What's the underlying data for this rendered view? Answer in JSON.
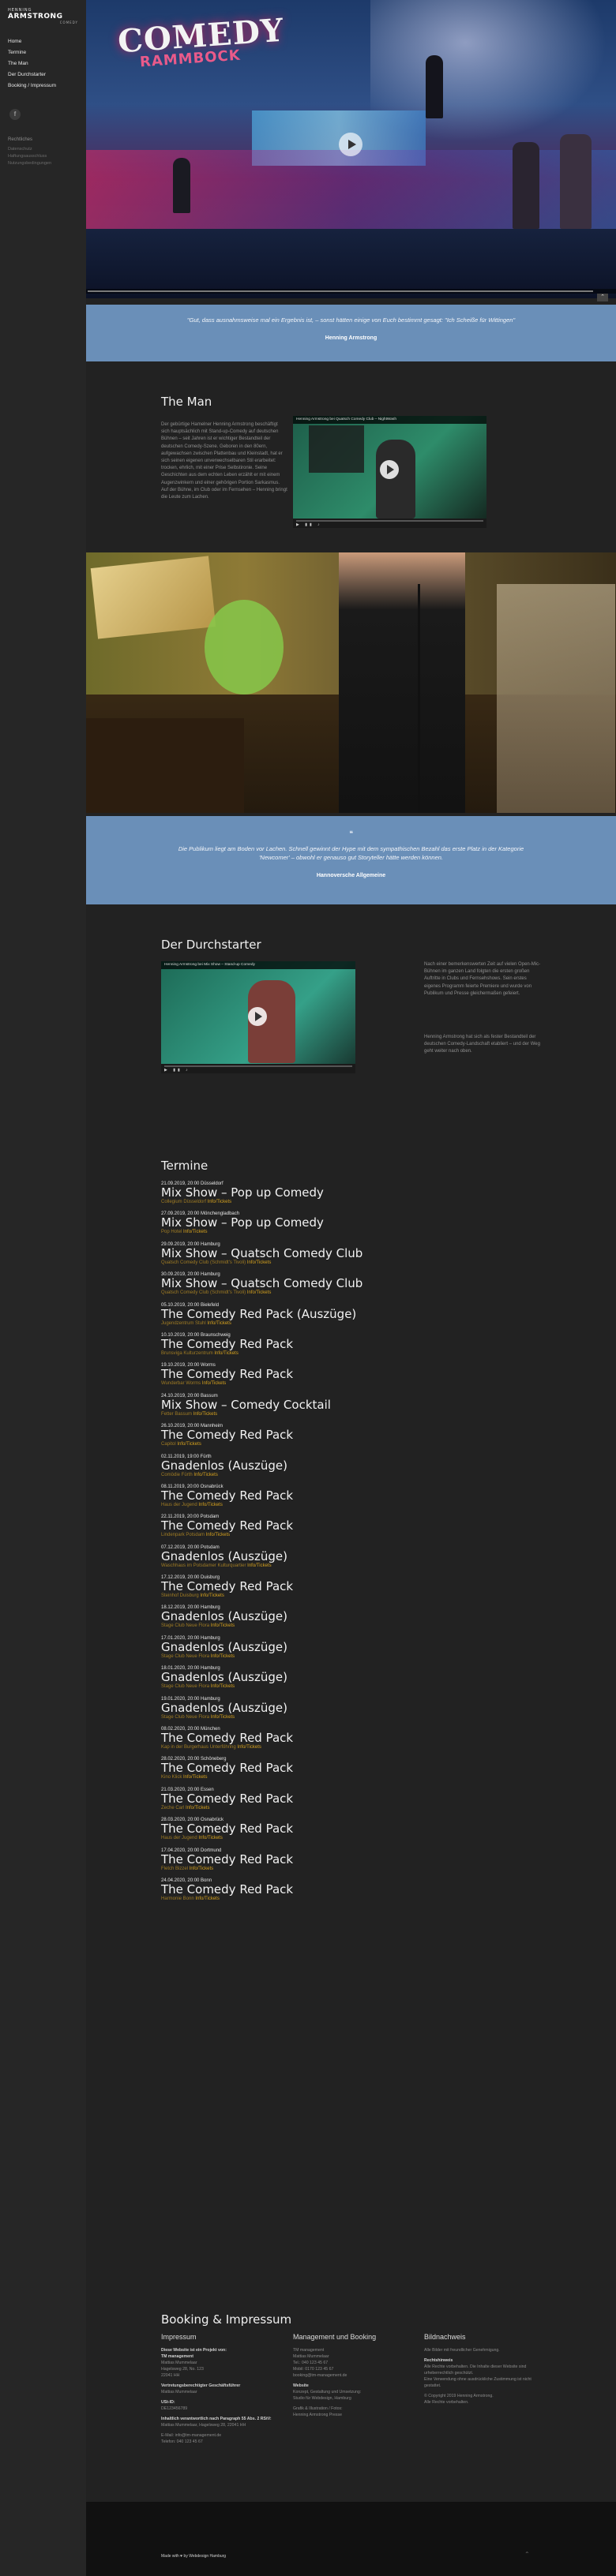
{
  "sidebar": {
    "logo": {
      "line1": "HENNING",
      "line2": "ARMSTRONG",
      "line3": "COMEDY"
    },
    "nav": [
      "Home",
      "Termine",
      "The Man",
      "Der Durchstarter",
      "Booking / Impressum"
    ],
    "legal_title": "Rechtliches",
    "legal_items": [
      "Datenschutz",
      "Haftungsausschluss",
      "Nutzungsbedingungen"
    ]
  },
  "hero": {
    "stage_title": "COMEDY",
    "stage_sub": "RAMMBOCK"
  },
  "quote1": {
    "text": "\"Gut, dass ausnahmsweise mal ein Ergebnis ist, – sonst hätten einige von Euch bestimmt gesagt: \"Ich Scheiße für Wittingen\"",
    "author": "Henning Armstrong"
  },
  "the_man": {
    "title": "The Man",
    "text": "Der gebürtige Hamelner Henning Armstrong beschäftigt sich hauptsächlich mit Stand-up-Comedy auf deutschen Bühnen – seit Jahren ist er wichtiger Bestandteil der deutschen Comedy-Szene. Geboren in den 80ern, aufgewachsen zwischen Plattenbau und Kleinstadt, hat er sich seinen eigenen unverwechselbaren Stil erarbeitet: trocken, ehrlich, mit einer Prise Selbstironie. Seine Geschichten aus dem echten Leben erzählt er mit einem Augenzwinkern und einer gehörigen Portion Sarkasmus. Auf der Bühne, im Club oder im Fernsehen – Henning bringt die Leute zum Lachen.",
    "video_title": "Henning Armstrong bei Quatsch Comedy Club – NightWash"
  },
  "quote2": {
    "icon": "❝",
    "text": "Die Publikum liegt am Boden vor Lachen. Schnell gewinnt der Hype mit dem sympathischen Bezahl das erste Platz in der Kategorie 'Newcomer' – obwohl er genauso gut Storyteller hätte werden können.",
    "author": "Hannoversche Allgemeine"
  },
  "durchstarter": {
    "title": "Der Durchstarter",
    "video_title": "Henning Armstrong bei Mix Show – Stand-up Comedy",
    "text1": "Nach einer bemerkenswerten Zeit auf vielen Open-Mic-Bühnen im ganzen Land folgten die ersten großen Auftritte in Clubs und Fernsehshows. Sein erstes eigenes Programm feierte Premiere und wurde von Publikum und Presse gleichermaßen gefeiert.",
    "text2": "Henning Armstrong hat sich als fester Bestandteil der deutschen Comedy-Landschaft etabliert – und der Weg geht weiter nach oben."
  },
  "termine": {
    "title": "Termine",
    "info_label": "Info/Tickets",
    "events": [
      {
        "date": "21.09.2019, 20:00 Düsseldorf",
        "title": "Mix Show – Pop up Comedy",
        "venue": "Collegium Düsseldorf"
      },
      {
        "date": "27.09.2019, 20:00 Mönchengladbach",
        "title": "Mix Show – Pop up Comedy",
        "venue": "Pop Hotel"
      },
      {
        "date": "29.09.2019, 20:00 Hamburg",
        "title": "Mix Show – Quatsch Comedy Club",
        "venue": "Quatsch Comedy Club (Schmidt's Tivoli)"
      },
      {
        "date": "30.09.2019, 20:00 Hamburg",
        "title": "Mix Show – Quatsch Comedy Club",
        "venue": "Quatsch Comedy Club (Schmidt's Tivoli)"
      },
      {
        "date": "05.10.2019, 20:00 Bielefeld",
        "title": "The Comedy Red Pack (Auszüge)",
        "venue": "Jugendzentrum Stuhl"
      },
      {
        "date": "10.10.2019, 20:00 Braunschweig",
        "title": "The Comedy Red Pack",
        "venue": "Brunsviga Kulturzentrum"
      },
      {
        "date": "19.10.2019, 20:00 Worms",
        "title": "The Comedy Red Pack",
        "venue": "Wunderbar Worms"
      },
      {
        "date": "24.10.2019, 20:00 Bassum",
        "title": "Mix Show – Comedy Cocktail",
        "venue": "Fetter Bassum"
      },
      {
        "date": "26.10.2019, 20:00 Mannheim",
        "title": "The Comedy Red Pack",
        "venue": "Capitol"
      },
      {
        "date": "02.11.2019, 19:00 Fürth",
        "title": "Gnadenlos (Auszüge)",
        "venue": "Comödie Fürth"
      },
      {
        "date": "08.11.2019, 20:00 Osnabrück",
        "title": "The Comedy Red Pack",
        "venue": "Haus der Jugend"
      },
      {
        "date": "22.11.2019, 20:00 Potsdam",
        "title": "The Comedy Red Pack",
        "venue": "Lindenpark Potsdam"
      },
      {
        "date": "07.12.2019, 20:00 Potsdam",
        "title": "Gnadenlos (Auszüge)",
        "venue": "Waschhaus im Potsdamer Kulturquartier"
      },
      {
        "date": "17.12.2019, 20:00 Duisburg",
        "title": "The Comedy Red Pack",
        "venue": "Steinhof Duisburg"
      },
      {
        "date": "18.12.2019, 20:00 Hamburg",
        "title": "Gnadenlos (Auszüge)",
        "venue": "Stage Club Neue Flora"
      },
      {
        "date": "17.01.2020, 20:00 Hamburg",
        "title": "Gnadenlos (Auszüge)",
        "venue": "Stage Club Neue Flora"
      },
      {
        "date": "18.01.2020, 20:00 Hamburg",
        "title": "Gnadenlos (Auszüge)",
        "venue": "Stage Club Neue Flora"
      },
      {
        "date": "19.01.2020, 20:00 Hamburg",
        "title": "Gnadenlos (Auszüge)",
        "venue": "Stage Club Neue Flora"
      },
      {
        "date": "08.02.2020, 20:00 München",
        "title": "The Comedy Red Pack",
        "venue": "Kap in der Burgerhaus Unterföhring"
      },
      {
        "date": "28.02.2020, 20:00 Schöneberg",
        "title": "The Comedy Red Pack",
        "venue": "Kino Klick"
      },
      {
        "date": "21.03.2020, 20:00 Essen",
        "title": "The Comedy Red Pack",
        "venue": "Zeche Carl"
      },
      {
        "date": "28.03.2020, 20:00 Osnabrück",
        "title": "The Comedy Red Pack",
        "venue": "Haus der Jugend"
      },
      {
        "date": "17.04.2020, 20:00 Dortmund",
        "title": "The Comedy Red Pack",
        "venue": "Fletch Bizzel"
      },
      {
        "date": "24.04.2020, 20:00 Bonn",
        "title": "The Comedy Red Pack",
        "venue": "Harmonie Bonn"
      }
    ]
  },
  "booking": {
    "title": "Booking & Impressum",
    "col1": {
      "head": "Impressum",
      "lines": [
        {
          "t": "Diese Website ist ein Projekt von:",
          "b": true
        },
        {
          "t": "TM management",
          "b": true
        },
        {
          "t": "Mattias Mummelaar",
          "b": false
        },
        {
          "t": "Hagelsweg 28, No. 123",
          "b": false
        },
        {
          "t": "22041 HH",
          "b": false
        },
        {
          "t": "",
          "b": false
        },
        {
          "t": "Vertretungsberechtigter Geschäftsführer",
          "b": true
        },
        {
          "t": "Mattias Mummelaar",
          "b": false
        },
        {
          "t": "",
          "b": false
        },
        {
          "t": "USt-ID:",
          "b": true
        },
        {
          "t": "DE123456789",
          "b": false
        },
        {
          "t": "",
          "b": false
        },
        {
          "t": "Inhaltlich verantwortlich nach Paragraph 55 Abs. 2 RStV:",
          "b": true
        },
        {
          "t": "Mattias Mummelaar, Hagelsweg 28, 22041 HH",
          "b": false
        },
        {
          "t": "",
          "b": false
        },
        {
          "t": "E-Mail: info@tm-management.de",
          "b": false
        },
        {
          "t": "Telefon: 040 123 45 67",
          "b": false
        }
      ]
    },
    "col2": {
      "head": "Management und Booking",
      "lines": [
        {
          "t": "TM management",
          "b": false
        },
        {
          "t": "Mattias Mummelaar",
          "b": false
        },
        {
          "t": "Tel.: 040 123 45 67",
          "b": false
        },
        {
          "t": "Mobil: 0170 123 45 67",
          "b": false
        },
        {
          "t": "booking@tm-management.de",
          "b": false
        },
        {
          "t": "",
          "b": false
        },
        {
          "t": "Website",
          "b": true
        },
        {
          "t": "Konzept, Gestaltung und Umsetzung:",
          "b": false
        },
        {
          "t": "Studio für Webdesign, Hamburg",
          "b": false
        },
        {
          "t": "",
          "b": false
        },
        {
          "t": "Grafik & Illustration / Fotos:",
          "b": false
        },
        {
          "t": "Henning Armstrong Presse",
          "b": false
        }
      ]
    },
    "col3": {
      "head": "Bildnachweis",
      "lines": [
        {
          "t": "Alle Bilder mit freundlicher Genehmigung.",
          "b": false
        },
        {
          "t": "",
          "b": false
        },
        {
          "t": "Rechtshinweis",
          "b": true
        },
        {
          "t": "Alle Rechte vorbehalten. Die Inhalte dieser Website sind urheberrechtlich geschützt.",
          "b": false
        },
        {
          "t": "Eine Verwendung ohne ausdrückliche Zustimmung ist nicht gestattet.",
          "b": false
        },
        {
          "t": "",
          "b": false
        },
        {
          "t": "© Copyright 2019 Henning Armstrong.",
          "b": false
        },
        {
          "t": "Alle Rechte vorbehalten.",
          "b": false
        }
      ]
    }
  },
  "footer": {
    "text": "Made with ♥ by Webdesign Hamburg"
  },
  "colors": {
    "accent_gold": "#d6a21e",
    "band_blue": "#6a8fb8",
    "background": "#222222"
  }
}
